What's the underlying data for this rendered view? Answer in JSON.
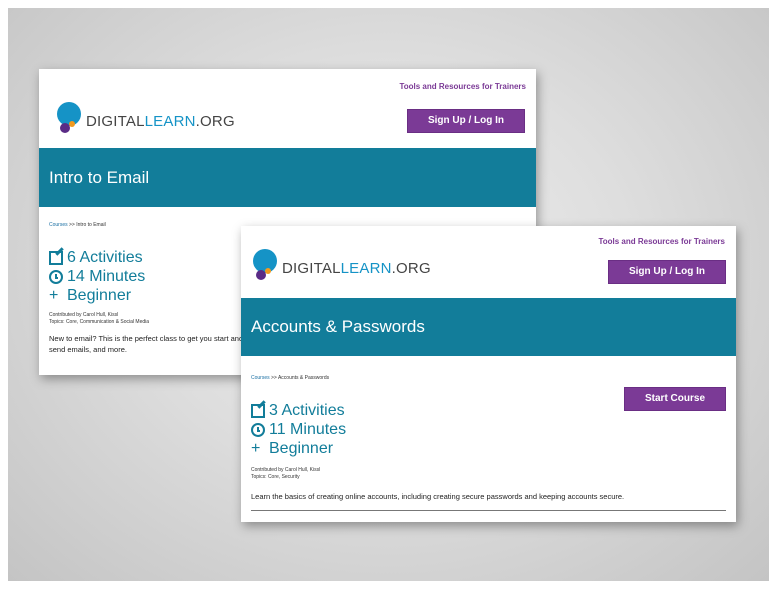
{
  "back_card": {
    "trainers_link": "Tools and Resources for Trainers",
    "logo": {
      "part1": "DIGITAL",
      "part2": "LEARN",
      "part3": ".ORG"
    },
    "signup_label": "Sign Up / Log In",
    "course_title": "Intro to Email",
    "breadcrumb": {
      "link": "Courses",
      "separator": " >> ",
      "current": "Intro to Email"
    },
    "activities": "6 Activities",
    "minutes": "14 Minutes",
    "level": "Beginner",
    "contributed": "Contributed by Carol Hull, Kissl",
    "topics": "Topics: Core, Communication & Social Media",
    "description": "New to email? This is the perfect class to get you start and send emails, and more."
  },
  "front_card": {
    "trainers_link": "Tools and Resources for Trainers",
    "logo": {
      "part1": "DIGITAL",
      "part2": "LEARN",
      "part3": ".ORG"
    },
    "signup_label": "Sign Up / Log In",
    "course_title": "Accounts & Passwords",
    "breadcrumb": {
      "link": "Courses",
      "separator": " >> ",
      "current": "Accounts & Passwords"
    },
    "start_label": "Start Course",
    "activities": "3 Activities",
    "minutes": "11 Minutes",
    "level": "Beginner",
    "contributed": "Contributed by Carol Hull, Kissl",
    "topics": "Topics: Core, Security",
    "description": "Learn the basics of creating online accounts, including creating secure passwords and keeping accounts secure."
  },
  "colors": {
    "brand_purple": "#7b3a96",
    "banner_teal": "#127d9a",
    "logo_blue": "#1593c6"
  }
}
